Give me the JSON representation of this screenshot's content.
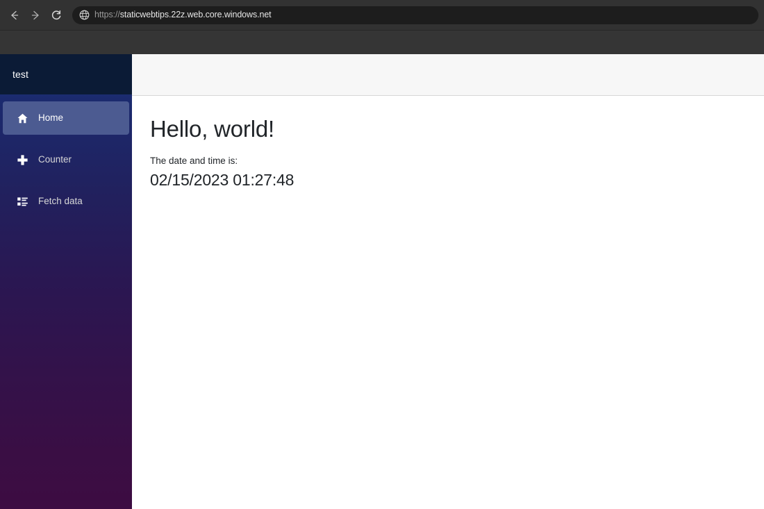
{
  "browser": {
    "back_icon": "back-arrow-icon",
    "forward_icon": "forward-arrow-icon",
    "reload_icon": "reload-icon",
    "site_icon": "globe-icon",
    "url_scheme": "https://",
    "url_host": "staticwebtips.22z.web.core.windows.net",
    "url_full": "https://staticwebtips.22z.web.core.windows.net"
  },
  "sidebar": {
    "brand": "test",
    "items": [
      {
        "label": "Home",
        "icon": "home-icon",
        "active": true
      },
      {
        "label": "Counter",
        "icon": "plus-icon",
        "active": false
      },
      {
        "label": "Fetch data",
        "icon": "list-icon",
        "active": false
      }
    ]
  },
  "main": {
    "title": "Hello, world!",
    "date_label": "The date and time is:",
    "date_value": "02/15/2023 01:27:48"
  },
  "colors": {
    "chrome_bg": "#323232",
    "address_bar_bg": "#1d1d1d",
    "sidebar_top": "#1b3a82",
    "sidebar_bottom": "#3d0c42",
    "sidebar_header": "#0b1b36",
    "nav_active": "#4c5b91",
    "top_row_bg": "#f7f7f7",
    "text_dark": "#212529"
  }
}
